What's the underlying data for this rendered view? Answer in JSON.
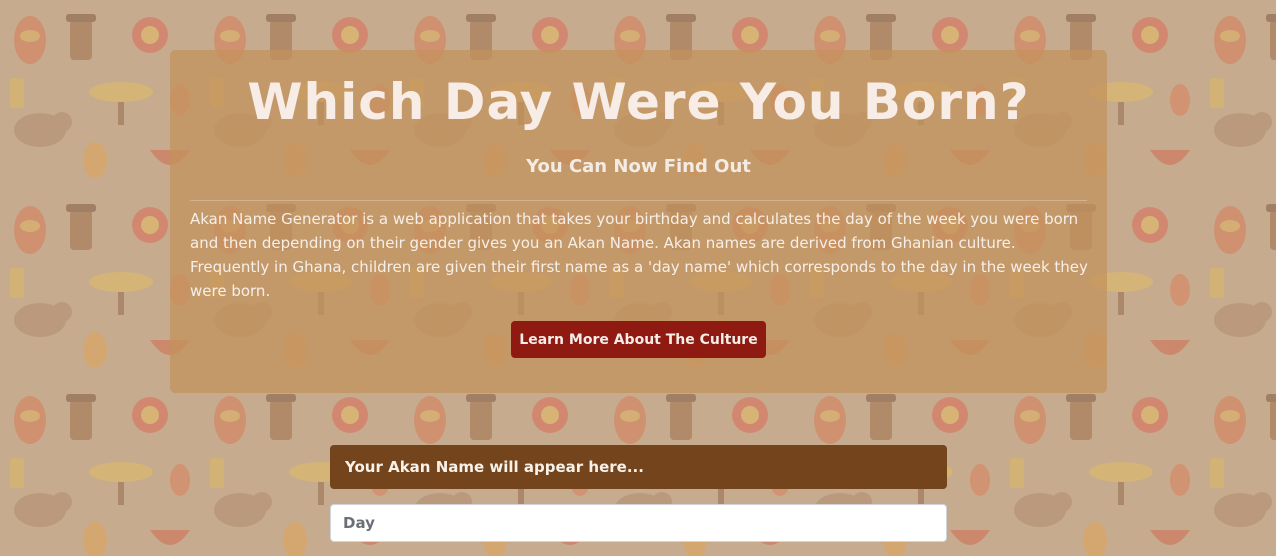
{
  "hero": {
    "title": "Which Day Were You Born?",
    "subtitle": "You Can Now Find Out",
    "description": "Akan Name Generator is a web application that takes your birthday and calculates the day of the week you were born and then depending on their gender gives you an Akan Name. Akan names are derived from Ghanian culture. Frequently in Ghana, children are given their first name as a 'day name' which corresponds to the day in the week they were born.",
    "learn_more_label": "Learn More About The Culture"
  },
  "form": {
    "result_text": "Your Akan Name will appear here...",
    "day_placeholder": "Day"
  },
  "colors": {
    "background": "#c6ab8f",
    "jumbotron": "#c4925c",
    "learn_button": "#8e1a12",
    "result_box": "#74451d",
    "title_text": "#f7ece6"
  }
}
